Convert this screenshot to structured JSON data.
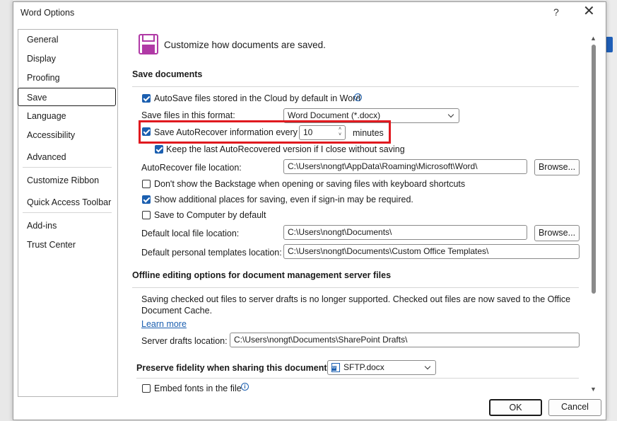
{
  "window": {
    "title": "Word Options",
    "help": "?",
    "close": "✕"
  },
  "nav": {
    "items": [
      "General",
      "Display",
      "Proofing",
      "Save",
      "Language",
      "Accessibility",
      "Advanced",
      "Customize Ribbon",
      "Quick Access Toolbar",
      "Add-ins",
      "Trust Center"
    ],
    "selected": "Save"
  },
  "header": {
    "text": "Customize how documents are saved.",
    "icon": "save-floppy-icon"
  },
  "save_documents": {
    "heading": "Save documents",
    "autosave": {
      "label": "AutoSave files stored in the Cloud by default in Word",
      "checked": true
    },
    "format": {
      "label": "Save files in this format:",
      "value": "Word Document (*.docx)"
    },
    "autorecover": {
      "label": "Save AutoRecover information every",
      "checked": true,
      "minutes": "10",
      "unit": "minutes"
    },
    "keep_last": {
      "label": "Keep the last AutoRecovered version if I close without saving",
      "checked": true
    },
    "ar_location": {
      "label": "AutoRecover file location:",
      "value": "C:\\Users\\nongt\\AppData\\Roaming\\Microsoft\\Word\\",
      "browse": "Browse..."
    },
    "dont_show_backstage": {
      "label": "Don't show the Backstage when opening or saving files with keyboard shortcuts",
      "checked": false
    },
    "show_places": {
      "label": "Show additional places for saving, even if sign-in may be required.",
      "checked": true
    },
    "save_computer": {
      "label": "Save to Computer by default",
      "checked": false
    },
    "local_location": {
      "label": "Default local file location:",
      "value": "C:\\Users\\nongt\\Documents\\",
      "browse": "Browse..."
    },
    "templates_location": {
      "label": "Default personal templates location:",
      "value": "C:\\Users\\nongt\\Documents\\Custom Office Templates\\"
    }
  },
  "offline": {
    "heading": "Offline editing options for document management server files",
    "text1": "Saving checked out files to server drafts is no longer supported. Checked out files are now saved to the Office",
    "text2": "Document Cache.",
    "learn_more": "Learn more",
    "drafts": {
      "label": "Server drafts location:",
      "value": "C:\\Users\\nongt\\Documents\\SharePoint Drafts\\"
    }
  },
  "fidelity": {
    "heading": "Preserve fidelity when sharing this document:",
    "doc": "SFTP.docx",
    "embed": {
      "label": "Embed fonts in the file",
      "checked": false
    }
  },
  "footer": {
    "ok": "OK",
    "cancel": "Cancel"
  },
  "colors": {
    "accent": "#1b5fb0",
    "highlight": "#e0191f",
    "save_icon": "#b03aa6"
  }
}
